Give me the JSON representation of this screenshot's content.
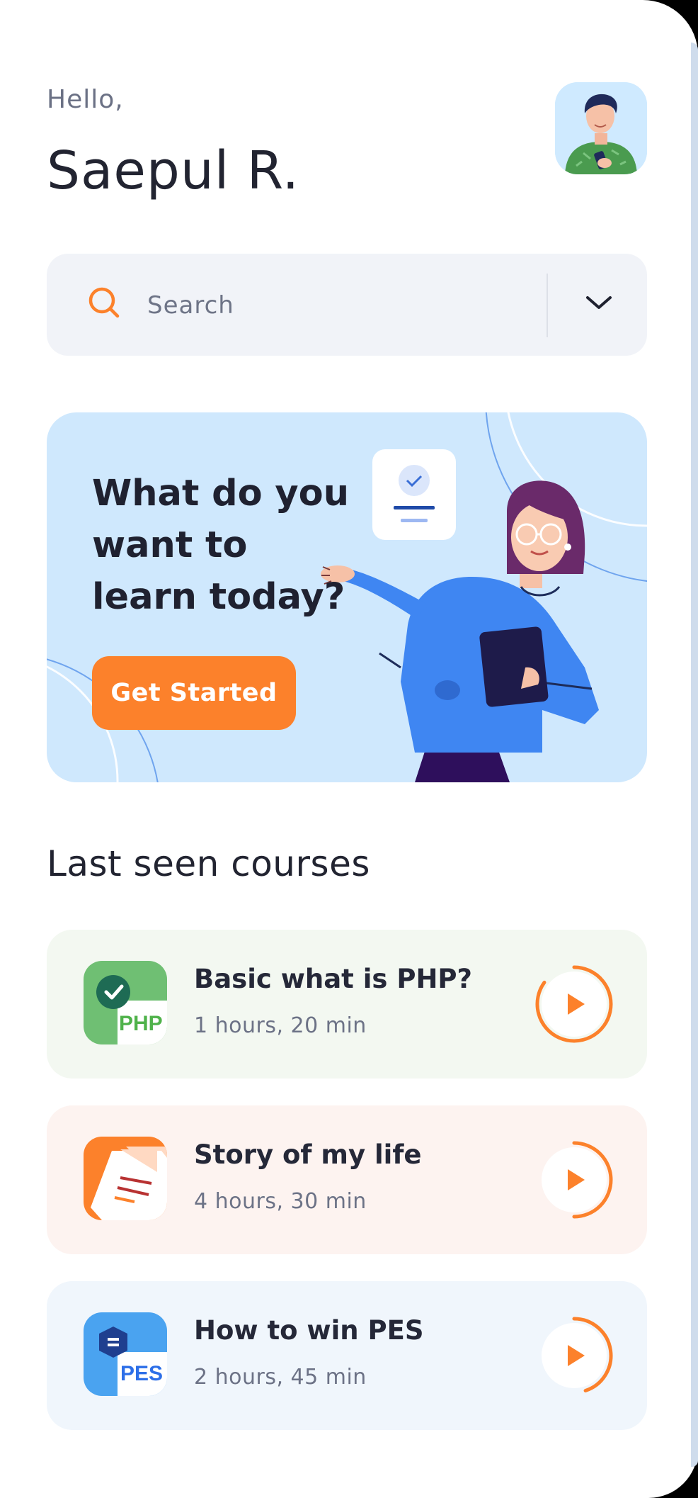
{
  "header": {
    "greeting": "Hello,",
    "username": "Saepul R."
  },
  "search": {
    "placeholder": "Search",
    "icon": "search-icon",
    "dropdown_icon": "chevron-down-icon"
  },
  "banner": {
    "headline": "What do you want to learn today?",
    "cta_label": "Get Started"
  },
  "section": {
    "title": "Last seen courses"
  },
  "courses": [
    {
      "title": "Basic what is PHP?",
      "duration": "1 hours, 20 min",
      "thumb_label": "PHP",
      "bg": "#f3f8f1",
      "progress": 0.85
    },
    {
      "title": "Story of my life",
      "duration": "4 hours, 30 min",
      "thumb_label": "",
      "bg": "#fdf3f0",
      "progress": 0.5
    },
    {
      "title": "How to win PES",
      "duration": "2 hours, 45 min",
      "thumb_label": "PES",
      "bg": "#f0f6fc",
      "progress": 0.45
    }
  ],
  "colors": {
    "accent": "#fc812b",
    "text_dark": "#222431",
    "banner_bg": "#cfe8fd"
  }
}
